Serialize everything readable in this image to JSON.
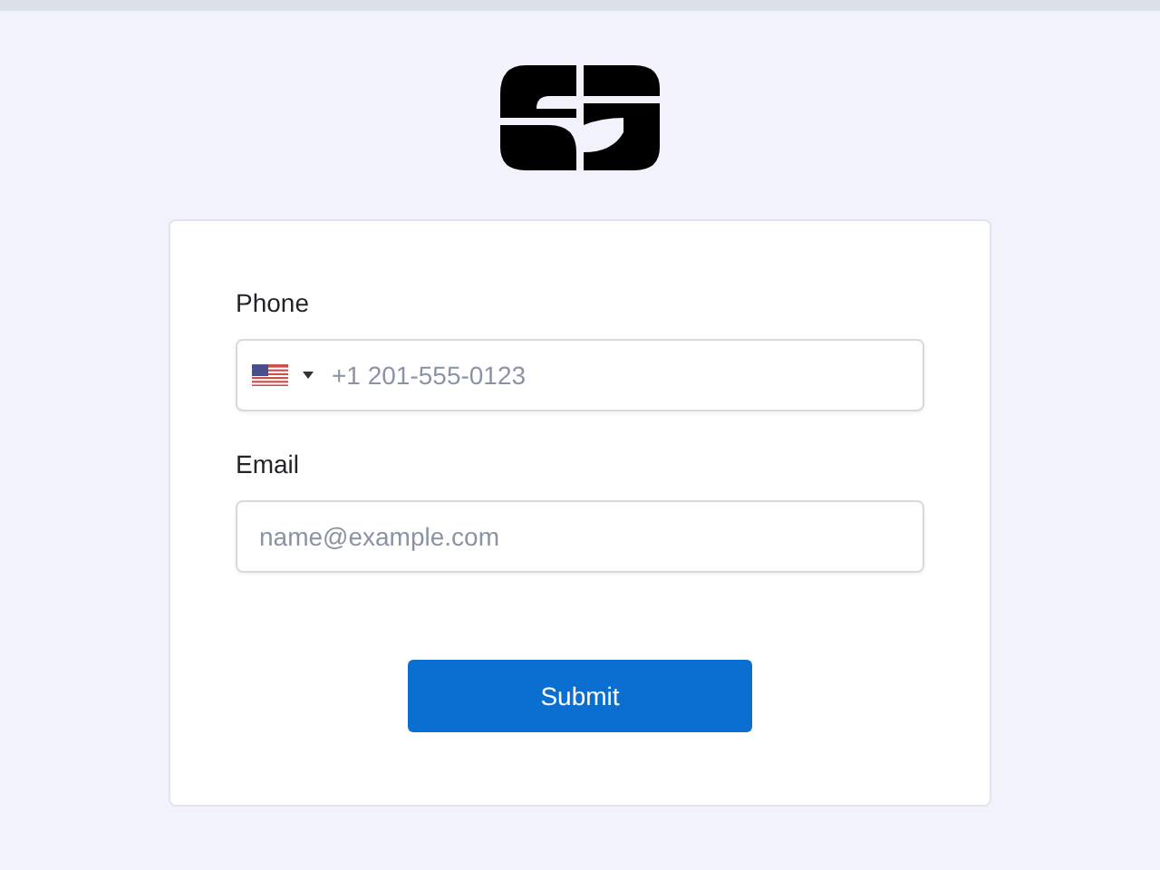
{
  "form": {
    "fields": [
      {
        "kind": "phone",
        "label": "Phone",
        "placeholder": "+1 201-555-0123"
      },
      {
        "kind": "email",
        "label": "Email",
        "placeholder": "name@example.com"
      }
    ],
    "submit": "Submit"
  }
}
